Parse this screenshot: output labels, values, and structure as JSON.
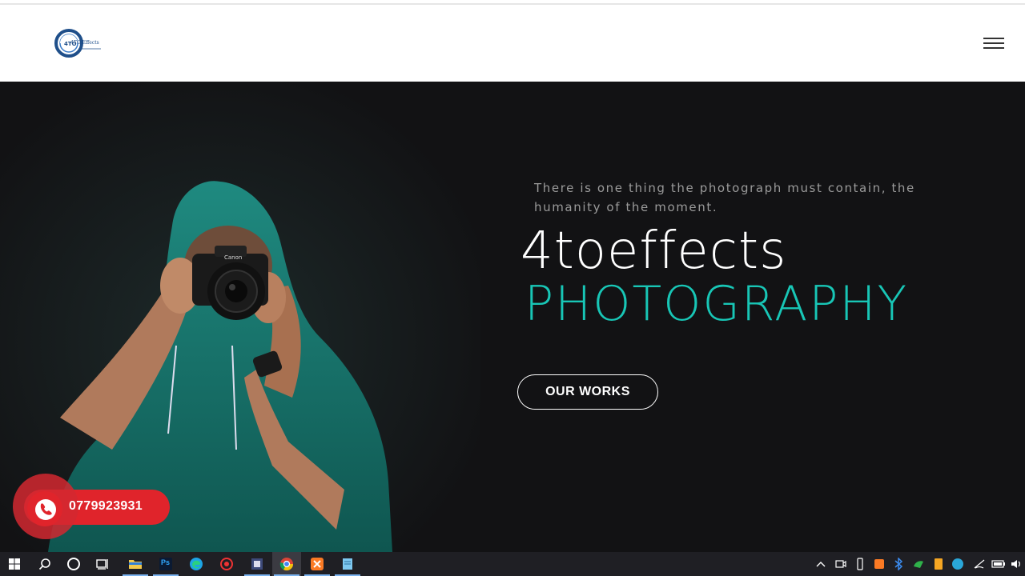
{
  "header": {
    "logo_alt": "4TO Effects",
    "logo_text": "4TO Effects",
    "menu_icon": "hamburger-icon"
  },
  "hero": {
    "quote": "There is one thing the photograph must contain, the humanity of the moment.",
    "brand": "4toeffects",
    "subtitle": "PHOTOGRAPHY",
    "cta_label": "OUR WORKS"
  },
  "contact": {
    "phone": "0779923931",
    "icon": "phone-icon"
  },
  "colors": {
    "accent": "#18c6b6",
    "hero_bg": "#121214",
    "phone_red": "#e0242b"
  },
  "taskbar": {
    "apps": [
      "windows-start-icon",
      "search-icon",
      "cortana-icon",
      "task-view-icon",
      "file-explorer-icon",
      "photoshop-icon",
      "edge-icon",
      "app-red-icon",
      "app-store-icon",
      "chrome-icon",
      "xampp-icon",
      "notepad-icon"
    ],
    "photoshop_label": "Ps",
    "tray": [
      "chevron-up-icon",
      "meet-now-icon",
      "usb-icon",
      "app-orange-icon",
      "bluetooth-icon",
      "app-green-icon",
      "app-yellow-icon",
      "app-blue-icon",
      "wifi-icon",
      "battery-icon",
      "volume-icon"
    ]
  }
}
